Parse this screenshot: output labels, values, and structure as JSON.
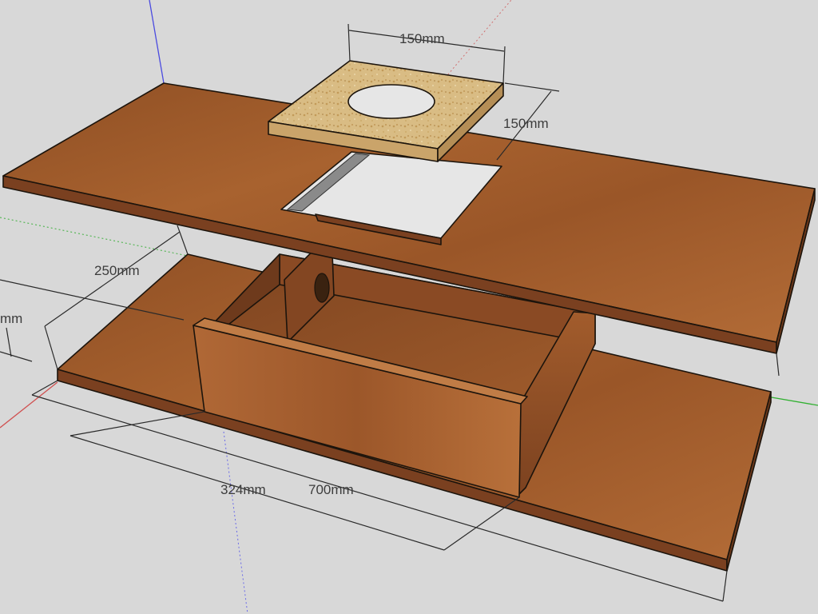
{
  "dimensions": {
    "insert_width": "150mm",
    "insert_depth": "150mm",
    "base_depth": "250mm",
    "base_partial_depth": "mm",
    "box_length": "324mm",
    "total_length": "700mm"
  },
  "colors": {
    "background": "#d8d8d8",
    "wood": "#9c5a2c",
    "wood_dark": "#7a4020",
    "wood_light": "#b06a38",
    "particleboard": "#dcc08a",
    "axis_blue": "#4a4ae0",
    "axis_red": "#d05050",
    "axis_green": "#30b030"
  }
}
